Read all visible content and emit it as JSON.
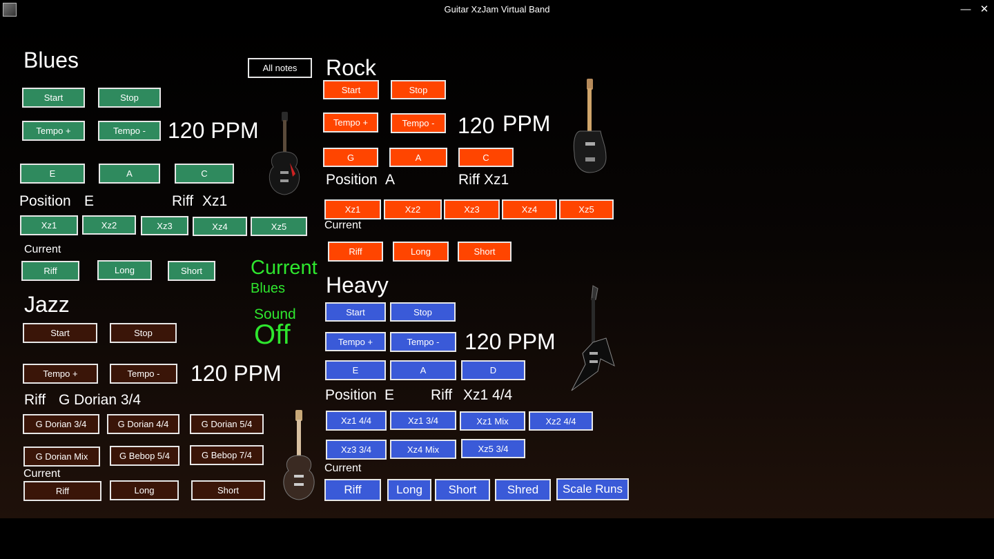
{
  "window": {
    "title": "Guitar XzJam Virtual Band",
    "min": "—",
    "max": "□",
    "close": "✕"
  },
  "all_notes": "All notes",
  "blues": {
    "title": "Blues",
    "start": "Start",
    "stop": "Stop",
    "tempo_up": "Tempo +",
    "tempo_down": "Tempo -",
    "ppm": "120 PPM",
    "keys": [
      "E",
      "A",
      "C"
    ],
    "position_label": "Position",
    "position_value": "E",
    "riff_label": "Riff",
    "riff_value": "Xz1",
    "riffs": [
      "Xz1",
      "Xz2",
      "Xz3",
      "Xz4",
      "Xz5"
    ],
    "current": "Current",
    "modes": [
      "Riff",
      "Long",
      "Short"
    ]
  },
  "rock": {
    "title": "Rock",
    "start": "Start",
    "stop": "Stop",
    "tempo_up": "Tempo +",
    "tempo_down": "Tempo -",
    "ppm_value": "120",
    "ppm_unit": "PPM",
    "keys": [
      "G",
      "A",
      "C"
    ],
    "position_label": "Position",
    "position_value": "A",
    "riff_text": "Riff Xz1",
    "riffs": [
      "Xz1",
      "Xz2",
      "Xz3",
      "Xz4",
      "Xz5"
    ],
    "current": "Current",
    "modes": [
      "Riff",
      "Long",
      "Short"
    ]
  },
  "status": {
    "current": "Current",
    "style": "Blues",
    "sound": "Sound",
    "state": "Off"
  },
  "jazz": {
    "title": "Jazz",
    "start": "Start",
    "stop": "Stop",
    "tempo_up": "Tempo +",
    "tempo_down": "Tempo -",
    "ppm": "120 PPM",
    "riff_label": "Riff",
    "riff_value": "G Dorian 3/4",
    "riffs": [
      "G Dorian 3/4",
      "G Dorian 4/4",
      "G Dorian 5/4",
      "G Dorian Mix",
      "G Bebop 5/4",
      "G Bebop 7/4"
    ],
    "current": "Current",
    "modes": [
      "Riff",
      "Long",
      "Short"
    ]
  },
  "heavy": {
    "title": "Heavy",
    "start": "Start",
    "stop": "Stop",
    "tempo_up": "Tempo +",
    "tempo_down": "Tempo -",
    "ppm": "120 PPM",
    "keys": [
      "E",
      "A",
      "D"
    ],
    "position_label": "Position",
    "position_value": "E",
    "riff_label": "Riff",
    "riff_value": "Xz1 4/4",
    "riffs": [
      "Xz1 4/4",
      "Xz1 3/4",
      "Xz1 Mix",
      "Xz2 4/4",
      "Xz3 3/4",
      "Xz4  Mix",
      "Xz5 3/4"
    ],
    "current": "Current",
    "modes": [
      "Riff",
      "Long",
      "Short",
      "Shred",
      "Scale Runs"
    ]
  },
  "colors": {
    "blues": "#2f8a5e",
    "rock": "#ff4500",
    "heavy": "#3a5ad8",
    "jazz": "#3a1508",
    "status": "#2ee62e"
  }
}
